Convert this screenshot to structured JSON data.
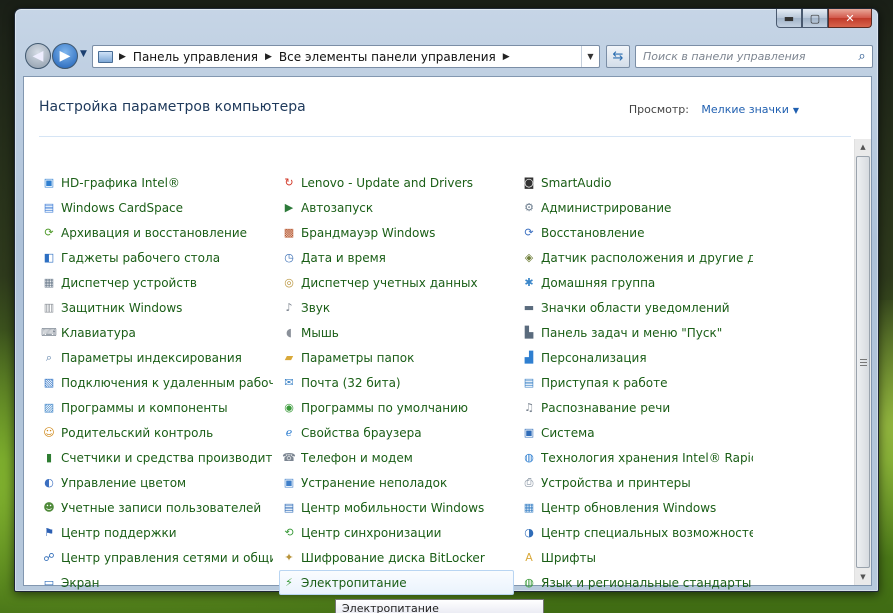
{
  "window": {
    "caption_buttons": {
      "minimize": "▬",
      "maximize": "▢",
      "close": "✕"
    }
  },
  "nav": {
    "back": "◀",
    "forward": "▶",
    "breadcrumb": [
      "Панель управления",
      "Все элементы панели управления"
    ],
    "search_placeholder": "Поиск в панели управления"
  },
  "header": {
    "title": "Настройка параметров компьютера",
    "view_label": "Просмотр:",
    "view_value": "Мелкие значки"
  },
  "columns": [
    [
      {
        "label": "HD-графика Intel®",
        "icon": "intel-graphics-icon",
        "color": "#2f7fd0",
        "glyph": "▣"
      },
      {
        "label": "Windows CardSpace",
        "icon": "cardspace-icon",
        "color": "#3b7bd6",
        "glyph": "▤"
      },
      {
        "label": "Архивация и восстановление",
        "icon": "backup-icon",
        "color": "#4f9a2a",
        "glyph": "⟳"
      },
      {
        "label": "Гаджеты рабочего стола",
        "icon": "gadgets-icon",
        "color": "#2d6fc2",
        "glyph": "◧"
      },
      {
        "label": "Диспетчер устройств",
        "icon": "device-manager-icon",
        "color": "#6b7b8c",
        "glyph": "▦"
      },
      {
        "label": "Защитник Windows",
        "icon": "defender-icon",
        "color": "#8a8f96",
        "glyph": "▥"
      },
      {
        "label": "Клавиатура",
        "icon": "keyboard-icon",
        "color": "#7b8591",
        "glyph": "⌨"
      },
      {
        "label": "Параметры индексирования",
        "icon": "indexing-icon",
        "color": "#5a7fa8",
        "glyph": "⌕"
      },
      {
        "label": "Подключения к удаленным рабоч...",
        "icon": "remote-connection-icon",
        "color": "#2f73c4",
        "glyph": "▧"
      },
      {
        "label": "Программы и компоненты",
        "icon": "programs-icon",
        "color": "#3f86c9",
        "glyph": "▨"
      },
      {
        "label": "Родительский контроль",
        "icon": "parental-control-icon",
        "color": "#d08a1c",
        "glyph": "☺"
      },
      {
        "label": "Счетчики и средства производител...",
        "icon": "performance-icon",
        "color": "#2e7d32",
        "glyph": "▮"
      },
      {
        "label": "Управление цветом",
        "icon": "color-management-icon",
        "color": "#3b6fc0",
        "glyph": "◐"
      },
      {
        "label": "Учетные записи пользователей",
        "icon": "user-accounts-icon",
        "color": "#4f8a3a",
        "glyph": "☻"
      },
      {
        "label": "Центр поддержки",
        "icon": "action-center-icon",
        "color": "#2b5fb3",
        "glyph": "⚑"
      },
      {
        "label": "Центр управления сетями и общи...",
        "icon": "network-center-icon",
        "color": "#2f6cb8",
        "glyph": "☍"
      },
      {
        "label": "Экран",
        "icon": "display-icon",
        "color": "#2f6cb8",
        "glyph": "▭"
      }
    ],
    [
      {
        "label": "Lenovo - Update and Drivers",
        "icon": "lenovo-update-icon",
        "color": "#d23a2a",
        "glyph": "↻"
      },
      {
        "label": "Автозапуск",
        "icon": "autoplay-icon",
        "color": "#2d7a3a",
        "glyph": "▶"
      },
      {
        "label": "Брандмауэр Windows",
        "icon": "firewall-icon",
        "color": "#b5532a",
        "glyph": "▩"
      },
      {
        "label": "Дата и время",
        "icon": "date-time-icon",
        "color": "#3b6fb5",
        "glyph": "◷"
      },
      {
        "label": "Диспетчер учетных данных",
        "icon": "credential-manager-icon",
        "color": "#b8933a",
        "glyph": "◎"
      },
      {
        "label": "Звук",
        "icon": "sound-icon",
        "color": "#7d8590",
        "glyph": "♪"
      },
      {
        "label": "Мышь",
        "icon": "mouse-icon",
        "color": "#8a9099",
        "glyph": "◖"
      },
      {
        "label": "Параметры папок",
        "icon": "folder-options-icon",
        "color": "#d9a93a",
        "glyph": "▰"
      },
      {
        "label": "Почта (32 бита)",
        "icon": "mail-icon",
        "color": "#3a82c6",
        "glyph": "✉"
      },
      {
        "label": "Программы по умолчанию",
        "icon": "default-programs-icon",
        "color": "#3a9a3a",
        "glyph": "◉"
      },
      {
        "label": "Свойства браузера",
        "icon": "internet-options-icon",
        "color": "#2f7fd0",
        "glyph": "ℯ"
      },
      {
        "label": "Телефон и модем",
        "icon": "phone-modem-icon",
        "color": "#7b8591",
        "glyph": "☎"
      },
      {
        "label": "Устранение неполадок",
        "icon": "troubleshooting-icon",
        "color": "#3f7fc9",
        "glyph": "▣"
      },
      {
        "label": "Центр мобильности Windows",
        "icon": "mobility-center-icon",
        "color": "#2f6cb8",
        "glyph": "▤"
      },
      {
        "label": "Центр синхронизации",
        "icon": "sync-center-icon",
        "color": "#3a9a3a",
        "glyph": "⟲"
      },
      {
        "label": "Шифрование диска BitLocker",
        "icon": "bitlocker-icon",
        "color": "#b8933a",
        "glyph": "✦"
      },
      {
        "label": "Электропитание",
        "icon": "power-options-icon",
        "color": "#3a9a3a",
        "glyph": "⚡",
        "selected": true
      }
    ],
    [
      {
        "label": "SmartAudio",
        "icon": "smartaudio-icon",
        "color": "#333333",
        "glyph": "◙"
      },
      {
        "label": "Администрирование",
        "icon": "admin-tools-icon",
        "color": "#6c7d8e",
        "glyph": "⚙"
      },
      {
        "label": "Восстановление",
        "icon": "recovery-icon",
        "color": "#3b6fc0",
        "glyph": "⟳"
      },
      {
        "label": "Датчик расположения и другие дат...",
        "icon": "location-sensor-icon",
        "color": "#6f7f3a",
        "glyph": "◈"
      },
      {
        "label": "Домашняя группа",
        "icon": "homegroup-icon",
        "color": "#3a86c9",
        "glyph": "✱"
      },
      {
        "label": "Значки области уведомлений",
        "icon": "notification-icons-icon",
        "color": "#5a6b7d",
        "glyph": "▬"
      },
      {
        "label": "Панель задач и меню \"Пуск\"",
        "icon": "taskbar-icon",
        "color": "#5a6b7d",
        "glyph": "▙"
      },
      {
        "label": "Персонализация",
        "icon": "personalization-icon",
        "color": "#2f7fd0",
        "glyph": "▟"
      },
      {
        "label": "Приступая к работе",
        "icon": "getting-started-icon",
        "color": "#3b82c6",
        "glyph": "▤"
      },
      {
        "label": "Распознавание речи",
        "icon": "speech-recognition-icon",
        "color": "#7b8591",
        "glyph": "♫"
      },
      {
        "label": "Система",
        "icon": "system-icon",
        "color": "#2f6cb8",
        "glyph": "▣"
      },
      {
        "label": "Технология хранения Intel® Rapid",
        "icon": "intel-rapid-storage-icon",
        "color": "#2f7fd0",
        "glyph": "◍"
      },
      {
        "label": "Устройства и принтеры",
        "icon": "devices-printers-icon",
        "color": "#6b7b8c",
        "glyph": "⎙"
      },
      {
        "label": "Центр обновления Windows",
        "icon": "windows-update-icon",
        "color": "#3b82c6",
        "glyph": "▦"
      },
      {
        "label": "Центр специальных возможностей",
        "icon": "ease-of-access-icon",
        "color": "#2f6cb8",
        "glyph": "◑"
      },
      {
        "label": "Шрифты",
        "icon": "fonts-icon",
        "color": "#d9a93a",
        "glyph": "A"
      },
      {
        "label": "Язык и региональные стандарты",
        "icon": "region-language-icon",
        "color": "#3a9a3a",
        "glyph": "◍"
      }
    ]
  ],
  "tooltip": "Электропитание"
}
